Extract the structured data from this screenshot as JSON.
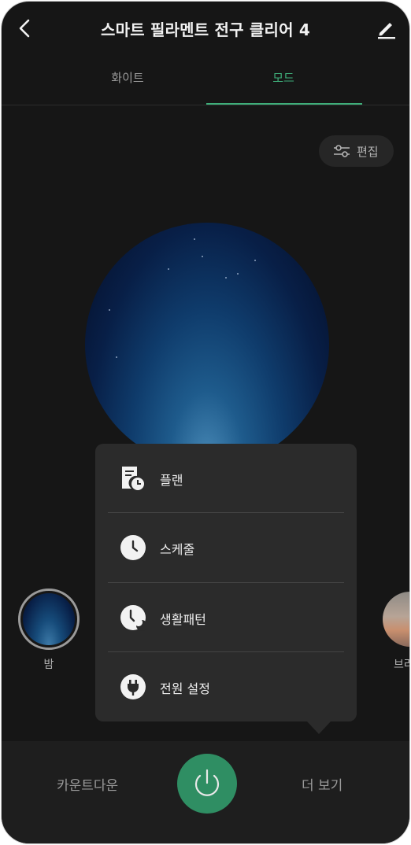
{
  "header": {
    "title": "스마트 필라멘트 전구 클리어 4",
    "back_icon": "chevron-left-icon",
    "edit_icon": "pencil-icon"
  },
  "tabs": [
    {
      "label": "화이트",
      "selected": false
    },
    {
      "label": "모드",
      "selected": true
    }
  ],
  "edit_chip": {
    "label": "편집",
    "icon": "sliders-icon"
  },
  "modes": [
    {
      "label": "밤",
      "selected": true
    },
    {
      "label": "브라",
      "selected": false
    }
  ],
  "menu": {
    "items": [
      {
        "label": "플랜",
        "icon": "plan-icon"
      },
      {
        "label": "스케줄",
        "icon": "clock-icon"
      },
      {
        "label": "생활패턴",
        "icon": "life-pattern-icon"
      },
      {
        "label": "전원 설정",
        "icon": "plug-icon"
      }
    ]
  },
  "bottom_bar": {
    "countdown_label": "카운트다운",
    "more_label": "더 보기",
    "power_icon": "power-icon"
  },
  "colors": {
    "background": "#161616",
    "accent": "#3fae7a",
    "power_button": "#2f8e63",
    "menu_background": "#2b2b2b"
  }
}
